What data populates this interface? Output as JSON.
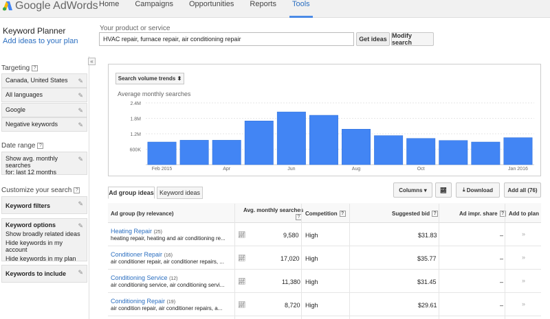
{
  "app": {
    "logo_text": "Google AdWords",
    "nav": [
      {
        "label": "Home"
      },
      {
        "label": "Campaigns"
      },
      {
        "label": "Opportunities"
      },
      {
        "label": "Reports"
      },
      {
        "label": "Tools",
        "active": true
      }
    ]
  },
  "header": {
    "title": "Keyword Planner",
    "subtitle": "Add ideas to your plan"
  },
  "search": {
    "label": "Your product or service",
    "value": "HVAC repair, furnace repair, air conditioning repair",
    "get_ideas": "Get ideas",
    "modify": "Modify search"
  },
  "sidebar": {
    "collapse": "«",
    "targeting_label": "Targeting",
    "targeting_items": [
      "Canada, United States",
      "All languages",
      "Google",
      "Negative keywords"
    ],
    "date_range_label": "Date range",
    "date_range_value_1": "Show avg. monthly searches",
    "date_range_value_2": "for: last 12 months",
    "customize_label": "Customize your search",
    "keyword_filters": "Keyword filters",
    "keyword_options_title": "Keyword options",
    "keyword_options": [
      "Show broadly related ideas",
      "Hide keywords in my account",
      "Hide keywords in my plan"
    ],
    "keywords_to_include": "Keywords to include"
  },
  "chart_panel": {
    "trend_button": "Search volume trends",
    "title": "Average monthly searches"
  },
  "chart_data": {
    "type": "bar",
    "categories": [
      "Feb 2015",
      "Mar 2015",
      "Apr",
      "May",
      "Jun",
      "Jul",
      "Aug",
      "Sep",
      "Oct",
      "Nov",
      "Dec",
      "Jan 2016"
    ],
    "x_tick_labels": [
      "Feb 2015",
      "Apr",
      "Jun",
      "Aug",
      "Oct",
      "Jan 2016"
    ],
    "x_tick_indices": [
      0,
      2,
      4,
      6,
      8,
      11
    ],
    "values": [
      880000,
      950000,
      950000,
      1700000,
      2050000,
      1920000,
      1380000,
      1130000,
      1020000,
      940000,
      880000,
      1050000
    ],
    "y_ticks": [
      "600K",
      "1.2M",
      "1.8M",
      "2.4M"
    ],
    "y_tick_values": [
      600000,
      1200000,
      1800000,
      2400000
    ],
    "ylim": [
      0,
      2400000
    ],
    "bar_color": "#4285f4",
    "grid": true
  },
  "tabs": [
    {
      "label": "Ad group ideas",
      "active": true
    },
    {
      "label": "Keyword ideas",
      "active": false
    }
  ],
  "toolbar": {
    "columns": "Columns",
    "download": "Download",
    "add_all": "Add all (76)"
  },
  "table": {
    "headers": {
      "ad_group": "Ad group (by relevance)",
      "searches": "Avg. monthly searches",
      "competition": "Competition",
      "bid": "Suggested bid",
      "impr": "Ad impr. share",
      "add": "Add to plan"
    },
    "rows": [
      {
        "name": "Heating Repair",
        "count": "(25)",
        "keywords": "heating repair, heating and air conditioning re...",
        "searches": "9,580",
        "competition": "High",
        "bid": "$31.83",
        "impr": "–"
      },
      {
        "name": "Conditioner Repair",
        "count": "(16)",
        "keywords": "air conditioner repair, air conditioner repairs, ...",
        "searches": "17,020",
        "competition": "High",
        "bid": "$35.77",
        "impr": "–"
      },
      {
        "name": "Conditioning Service",
        "count": "(12)",
        "keywords": "air conditioning service, air conditioning servi...",
        "searches": "11,380",
        "competition": "High",
        "bid": "$31.45",
        "impr": "–"
      },
      {
        "name": "Conditioning Repair",
        "count": "(19)",
        "keywords": "air condition repair, air conditioner repairs, a...",
        "searches": "8,720",
        "competition": "High",
        "bid": "$29.61",
        "impr": "–"
      }
    ]
  },
  "colors": {
    "accent": "#2a6ec0",
    "bar": "#4285f4"
  }
}
